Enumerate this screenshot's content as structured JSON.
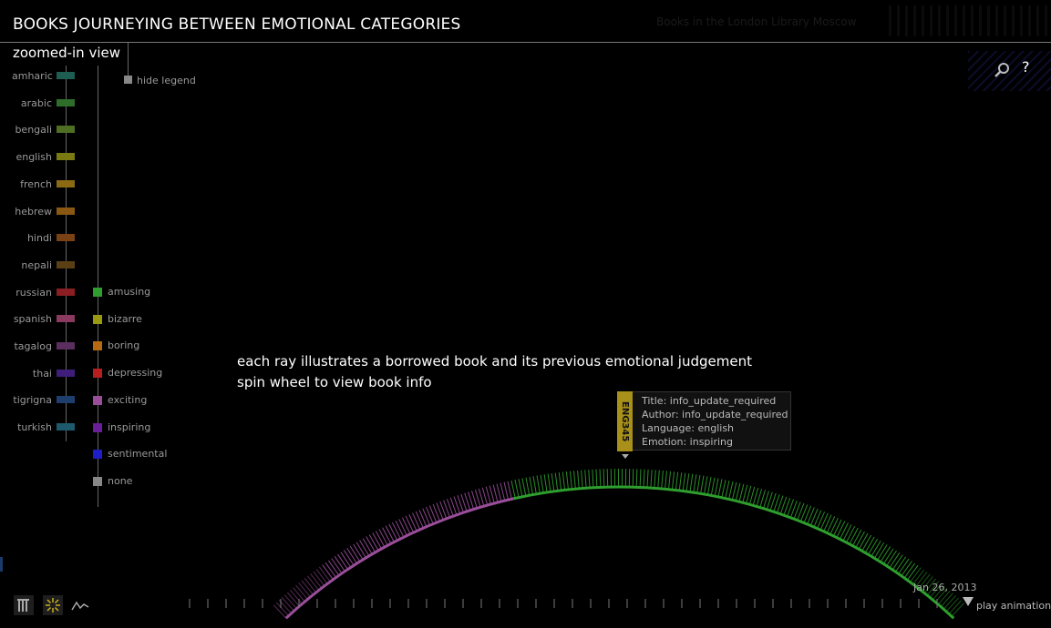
{
  "header": {
    "title": "BOOKS JOURNEYING BETWEEN EMOTIONAL CATEGORIES",
    "subtitle": "zoomed-in view",
    "top_note": "Books in the London Library Moscow"
  },
  "toolbar": {
    "search_icon": "magnifier-icon",
    "help_label": "?"
  },
  "legend": {
    "hide_label": "hide legend",
    "languages": [
      {
        "label": "amharic",
        "color": "#1e5e52"
      },
      {
        "label": "arabic",
        "color": "#2e6e2a"
      },
      {
        "label": "bengali",
        "color": "#4e6e22"
      },
      {
        "label": "english",
        "color": "#7a7a12"
      },
      {
        "label": "french",
        "color": "#8a6a12"
      },
      {
        "label": "hebrew",
        "color": "#8a5812"
      },
      {
        "label": "hindi",
        "color": "#7a4214"
      },
      {
        "label": "nepali",
        "color": "#5a3e14"
      },
      {
        "label": "russian",
        "color": "#8a1e22"
      },
      {
        "label": "spanish",
        "color": "#8a3a5e"
      },
      {
        "label": "tagalog",
        "color": "#5a2e5e"
      },
      {
        "label": "thai",
        "color": "#3e1e7a"
      },
      {
        "label": "tigrigna",
        "color": "#1e3e6e"
      },
      {
        "label": "turkish",
        "color": "#1e5a6e"
      }
    ],
    "emotions": [
      {
        "label": "amusing",
        "color": "#2e9e2e"
      },
      {
        "label": "bizarre",
        "color": "#9a9a12"
      },
      {
        "label": "boring",
        "color": "#b86a12"
      },
      {
        "label": "depressing",
        "color": "#b81e1e"
      },
      {
        "label": "exciting",
        "color": "#9a4e9a"
      },
      {
        "label": "inspiring",
        "color": "#6a1e9a"
      },
      {
        "label": "sentimental",
        "color": "#1e1ec8"
      },
      {
        "label": "none",
        "color": "#888888"
      }
    ]
  },
  "instructions": {
    "line1": "each ray illustrates a borrowed book and its previous emotional judgement",
    "line2": "spin wheel to view book info"
  },
  "tooltip": {
    "id": "ENG345",
    "title": "Title: info_update_required",
    "author": "Author: info_update_required",
    "language": "Language: english",
    "emotion": "Emotion: inspiring",
    "tag_color": "#a8901a"
  },
  "wheel": {
    "segments": [
      {
        "emotion": "exciting",
        "color": "#9a4e9a"
      },
      {
        "emotion": "amusing",
        "color": "#2e9e2e"
      }
    ]
  },
  "timeline": {
    "date": "Jan 26, 2013",
    "play_label": "play animation"
  },
  "bottom_tools": [
    {
      "icon": "bar-chart-icon"
    },
    {
      "icon": "wheel-icon"
    },
    {
      "icon": "line-chart-icon"
    }
  ]
}
